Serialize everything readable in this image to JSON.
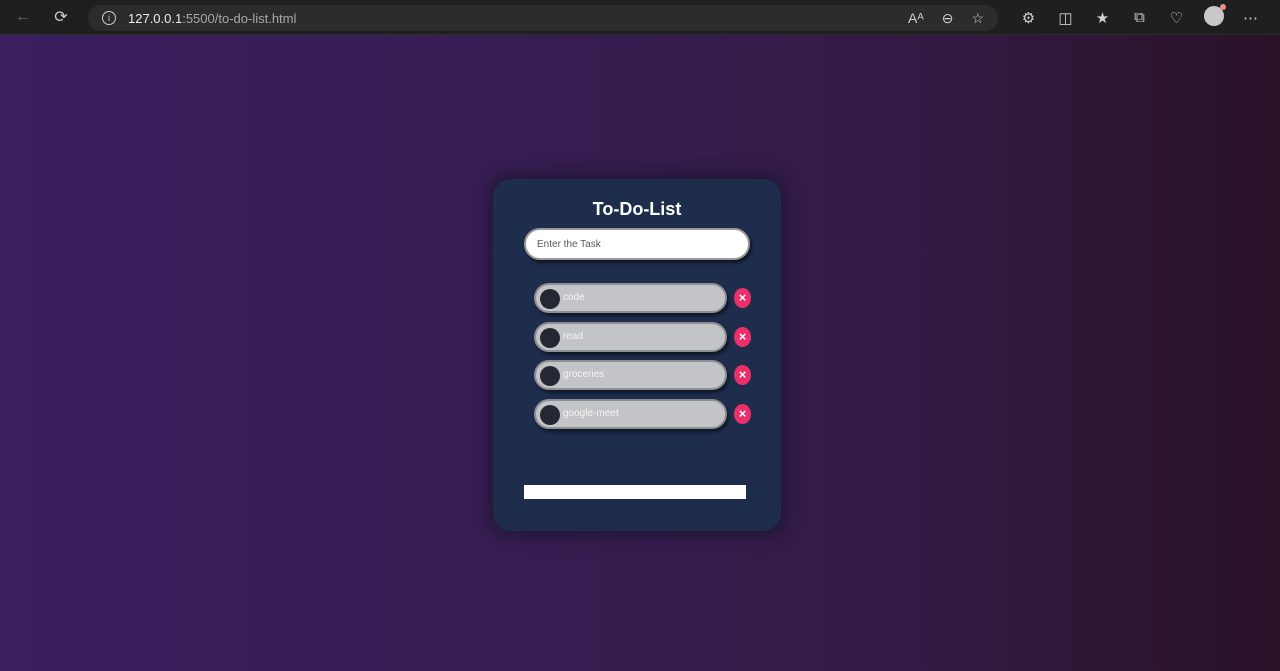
{
  "browser": {
    "url_host": "127.0.0.1",
    "url_path": ":5500/to-do-list.html"
  },
  "app": {
    "title": "To-Do-List",
    "input_placeholder": "Enter the Task",
    "tasks": [
      {
        "label": "code"
      },
      {
        "label": "read"
      },
      {
        "label": "groceries"
      },
      {
        "label": "google-meet"
      }
    ],
    "delete_symbol": "×"
  },
  "colors": {
    "card_bg": "#1f2d4d",
    "delete": "#ec2f6b",
    "pill": "#c3c4c8"
  }
}
